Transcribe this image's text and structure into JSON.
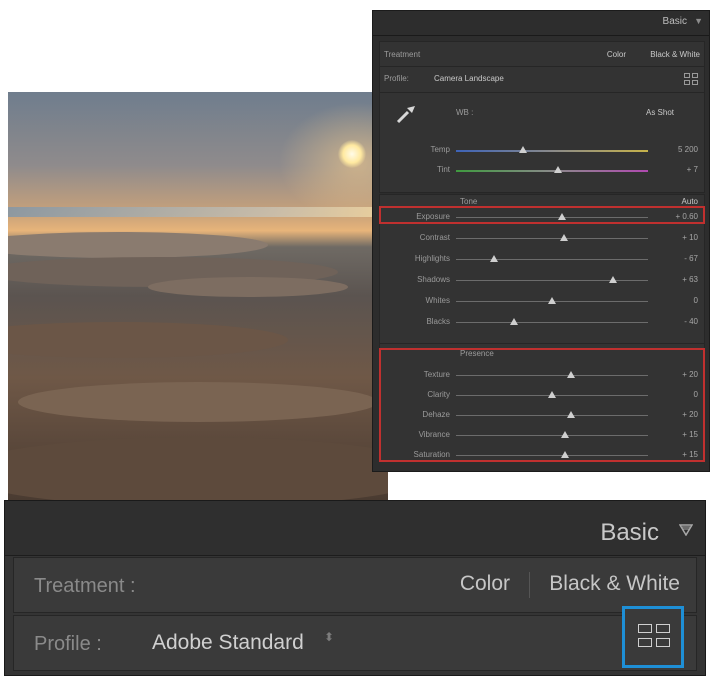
{
  "small_panel": {
    "title": "Basic",
    "treatment_label": "Treatment",
    "treatment_color": "Color",
    "treatment_bw": "Black & White",
    "profile_label": "Profile:",
    "profile_value": "Camera Landscape",
    "wb_label": "WB :",
    "wb_value": "As Shot",
    "temp_label": "Temp",
    "temp_value": "5 200",
    "tint_label": "Tint",
    "tint_value": "+ 7",
    "tone_label": "Tone",
    "auto_label": "Auto",
    "presence_label": "Presence",
    "tone_sliders": [
      {
        "label": "Exposure",
        "value": "+ 0.60",
        "pos": 0.55
      },
      {
        "label": "Contrast",
        "value": "+ 10",
        "pos": 0.56
      },
      {
        "label": "Highlights",
        "value": "- 67",
        "pos": 0.2
      },
      {
        "label": "Shadows",
        "value": "+ 63",
        "pos": 0.82
      },
      {
        "label": "Whites",
        "value": "0",
        "pos": 0.5
      },
      {
        "label": "Blacks",
        "value": "- 40",
        "pos": 0.3
      }
    ],
    "presence_sliders": [
      {
        "label": "Texture",
        "value": "+ 20",
        "pos": 0.6
      },
      {
        "label": "Clarity",
        "value": "0",
        "pos": 0.5
      },
      {
        "label": "Dehaze",
        "value": "+ 20",
        "pos": 0.6
      },
      {
        "label": "Vibrance",
        "value": "+ 15",
        "pos": 0.57
      },
      {
        "label": "Saturation",
        "value": "+ 15",
        "pos": 0.57
      }
    ]
  },
  "big_panel": {
    "title": "Basic",
    "treatment_label": "Treatment :",
    "treatment_color": "Color",
    "treatment_bw": "Black & White",
    "profile_label": "Profile :",
    "profile_value": "Adobe Standard",
    "updown": "⬍"
  },
  "colors": {
    "highlight_red": "#c0302f",
    "highlight_blue": "#1e8fd6"
  },
  "icons": [
    "eyedropper-icon",
    "panel-collapse-icon",
    "profile-browser-grid-icon",
    "updown-arrows-icon"
  ]
}
